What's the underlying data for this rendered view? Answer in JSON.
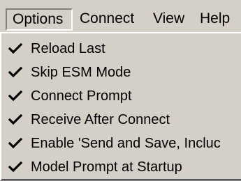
{
  "menubar": {
    "menus": [
      {
        "label": "Options"
      },
      {
        "label": "Connect"
      },
      {
        "label": "View"
      },
      {
        "label": "Help"
      }
    ]
  },
  "options_menu": {
    "items": [
      {
        "label": "Reload Last",
        "checked": true,
        "icon": "checkmark-icon"
      },
      {
        "label": "Skip ESM Mode",
        "checked": true,
        "icon": "checkmark-icon"
      },
      {
        "label": "Connect Prompt",
        "checked": true,
        "icon": "checkmark-icon"
      },
      {
        "label": "Receive After Connect",
        "checked": true,
        "icon": "checkmark-icon"
      },
      {
        "label": "Enable 'Send and Save, Incluc",
        "checked": true,
        "icon": "checkmark-icon"
      },
      {
        "label": "Model Prompt at Startup",
        "checked": true,
        "icon": "checkmark-icon"
      }
    ]
  },
  "colors": {
    "menu_background": "#d4d0c8",
    "highlight": "#ffffff",
    "shadow": "#808080",
    "text": "#000000"
  }
}
